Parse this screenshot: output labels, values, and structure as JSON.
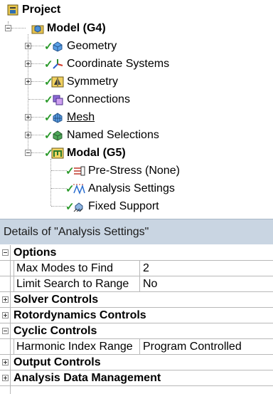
{
  "tree": {
    "project": "Project",
    "model": "Model (G4)",
    "geometry": "Geometry",
    "coordinate_systems": "Coordinate Systems",
    "symmetry": "Symmetry",
    "connections": "Connections",
    "mesh": "Mesh",
    "named_selections": "Named Selections",
    "modal": "Modal (G5)",
    "pre_stress": "Pre-Stress (None)",
    "analysis_settings": "Analysis Settings",
    "fixed_support": "Fixed Support"
  },
  "details": {
    "title": "Details of \"Analysis Settings\"",
    "options": "Options",
    "max_modes_label": "Max Modes to Find",
    "max_modes_value": "2",
    "limit_search_label": "Limit Search to Range",
    "limit_search_value": "No",
    "solver_controls": "Solver Controls",
    "rotordynamics_controls": "Rotordynamics Controls",
    "cyclic_controls": "Cyclic Controls",
    "harmonic_label": "Harmonic Index Range",
    "harmonic_value": "Program Controlled",
    "output_controls": "Output Controls",
    "data_management": "Analysis Data Management"
  },
  "colors": {
    "check": "#2b9a2b",
    "header_bg": "#c9d5e2"
  }
}
